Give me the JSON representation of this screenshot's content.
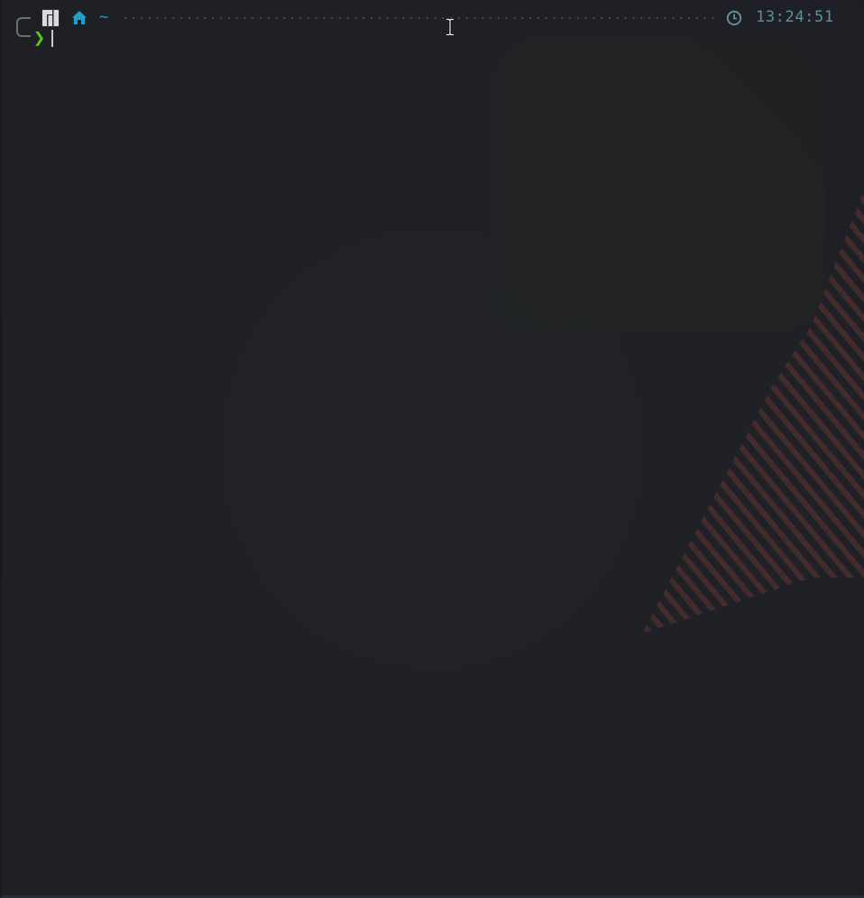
{
  "prompt": {
    "os_icon": "manjaro-logo-icon",
    "home_icon": "home-icon",
    "directory": "~",
    "clock_icon": "clock-icon",
    "time": "13:24:51",
    "prompt_symbol": "❯"
  },
  "colors": {
    "background": "#202228",
    "directory": "#1f9ec9",
    "time": "#5f8f98",
    "prompt_symbol": "#58c41f",
    "filler_dots": "#4c5058"
  },
  "pointer": "ibeam-cursor-icon"
}
